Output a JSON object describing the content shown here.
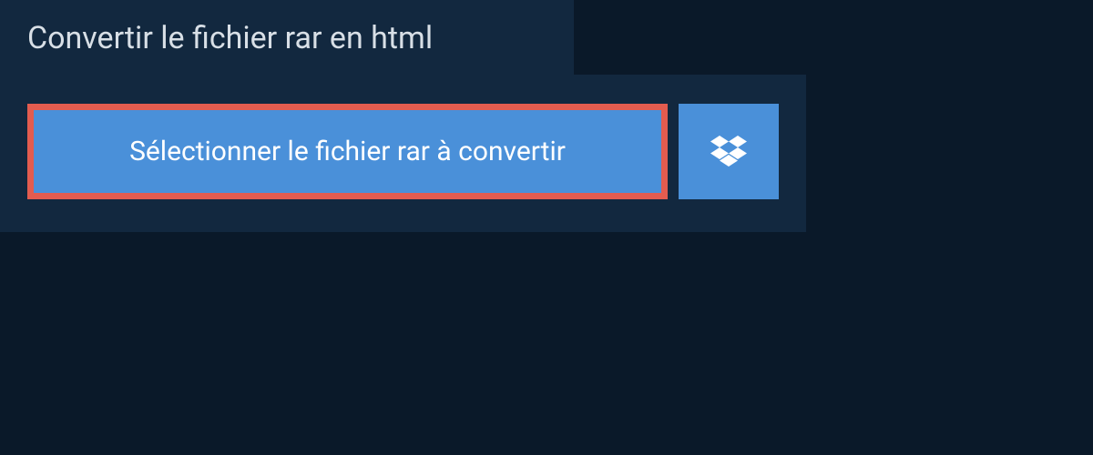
{
  "tab": {
    "title": "Convertir le fichier rar en html"
  },
  "buttons": {
    "select_label": "Sélectionner le fichier rar à convertir"
  },
  "colors": {
    "background": "#0a1929",
    "panel": "#12283f",
    "button": "#4a90d9",
    "highlight_border": "#e35c4f",
    "text_light": "#d8dfe6",
    "text_white": "#ffffff"
  }
}
